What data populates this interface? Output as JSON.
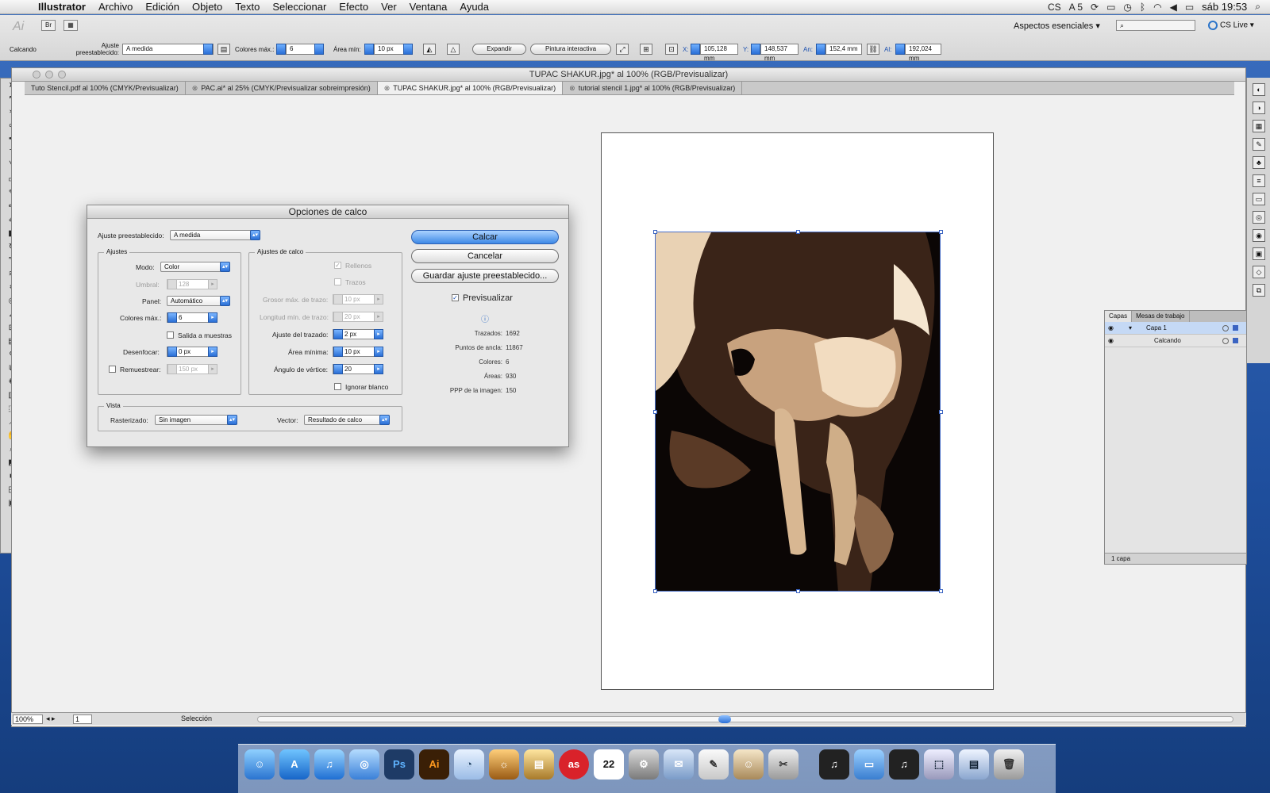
{
  "menubar": {
    "app": "Illustrator",
    "items": [
      "Archivo",
      "Edición",
      "Objeto",
      "Texto",
      "Seleccionar",
      "Efecto",
      "Ver",
      "Ventana",
      "Ayuda"
    ],
    "right": {
      "cs": "CS",
      "adobe": "A 5",
      "clock": "sáb 19:53"
    }
  },
  "control": {
    "object_label": "Calcando",
    "preset_label": "Ajuste preestablecido:",
    "preset_value": "A medida",
    "max_colors_label": "Colores máx.:",
    "max_colors_value": "6",
    "min_area_label": "Área mín:",
    "min_area_value": "10 px",
    "expand": "Expandir",
    "live_paint": "Pintura interactiva",
    "x_label": "X:",
    "x_value": "105,128 mm",
    "y_label": "Y:",
    "y_value": "148,537 mm",
    "w_label": "An:",
    "w_value": "152,4 mm",
    "h_label": "Al:",
    "h_value": "192,024 mm",
    "workspace": "Aspectos esenciales",
    "cslive": "CS Live"
  },
  "document": {
    "title": "TUPAC SHAKUR.jpg* al 100% (RGB/Previsualizar)",
    "tabs": [
      {
        "label": "Tuto Stencil.pdf al 100% (CMYK/Previsualizar)"
      },
      {
        "label": "PAC.ai* al 25% (CMYK/Previsualizar sobreimpresión)"
      },
      {
        "label": "TUPAC SHAKUR.jpg* al 100% (RGB/Previsualizar)"
      },
      {
        "label": "tutorial stencil 1.jpg* al 100% (RGB/Previsualizar)"
      }
    ]
  },
  "status": {
    "zoom": "100%",
    "page": "1",
    "tool": "Selección"
  },
  "layers": {
    "tabs": [
      "Capas",
      "Mesas de trabajo"
    ],
    "rows": [
      {
        "name": "Capa 1"
      },
      {
        "name": "Calcando"
      }
    ],
    "footer": "1 capa"
  },
  "dialog": {
    "title": "Opciones de calco",
    "preset_label": "Ajuste preestablecido:",
    "preset_value": "A medida",
    "ajustes": {
      "group": "Ajustes",
      "mode_label": "Modo:",
      "mode_value": "Color",
      "threshold_label": "Umbral:",
      "threshold_value": "128",
      "panel_label": "Panel:",
      "panel_value": "Automático",
      "max_colors_label": "Colores máx.:",
      "max_colors_value": "6",
      "output_swatches": "Salida a muestras",
      "blur_label": "Desenfocar:",
      "blur_value": "0 px",
      "resample_label": "Remuestrear:",
      "resample_value": "150 px"
    },
    "trace": {
      "group": "Ajustes de calco",
      "fills": "Rellenos",
      "strokes": "Trazos",
      "max_stroke_label": "Grosor máx. de trazo:",
      "max_stroke_value": "10 px",
      "min_stroke_label": "Longitud mín. de trazo:",
      "min_stroke_value": "20 px",
      "path_fit_label": "Ajuste del trazado:",
      "path_fit_value": "2 px",
      "min_area_label": "Área mínima:",
      "min_area_value": "10 px",
      "corner_label": "Ángulo de vértice:",
      "corner_value": "20",
      "ignore_white": "Ignorar blanco"
    },
    "view": {
      "group": "Vista",
      "raster_label": "Rasterizado:",
      "raster_value": "Sin imagen",
      "vector_label": "Vector:",
      "vector_value": "Resultado de calco"
    },
    "buttons": {
      "trace": "Calcar",
      "cancel": "Cancelar",
      "save_preset": "Guardar ajuste preestablecido..."
    },
    "preview_label": "Previsualizar",
    "stats": [
      {
        "k": "Trazados:",
        "v": "1692"
      },
      {
        "k": "Puntos de ancla:",
        "v": "11867"
      },
      {
        "k": "Colores:",
        "v": "6"
      },
      {
        "k": "Áreas:",
        "v": "930"
      },
      {
        "k": "PPP de la imagen:",
        "v": "150"
      }
    ]
  },
  "dock": {
    "items": [
      "finder-icon",
      "app-store-icon",
      "itunes-icon",
      "safari-icon",
      "Ps",
      "Ai",
      "preview-icon",
      "iphoto-icon",
      "lastfm-icon",
      "22",
      "system-prefs-icon",
      "mail-icon",
      "textedit-icon",
      "itunes-icon",
      "folder-icon",
      "trash-icon"
    ]
  }
}
